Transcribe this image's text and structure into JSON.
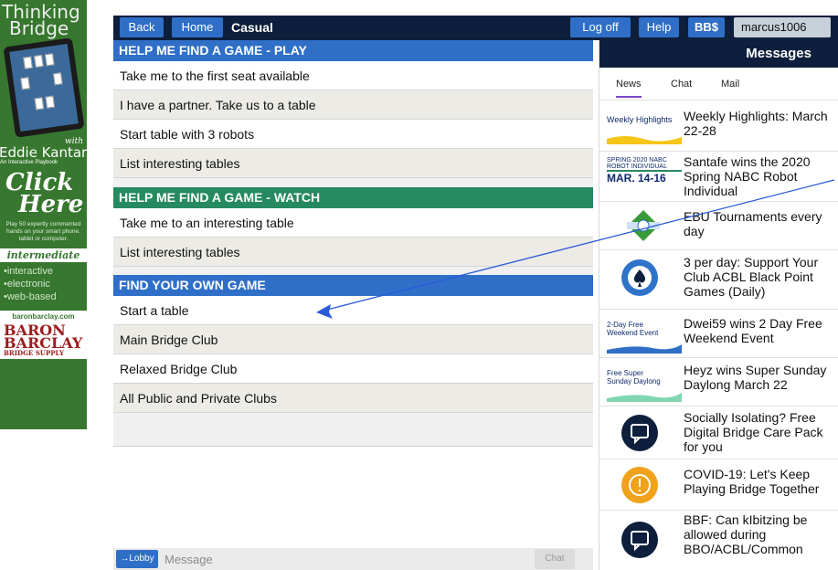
{
  "ad": {
    "brand_line1": "Thinking",
    "brand_line2": "Bridge",
    "with": "with",
    "author": "Eddie Kantar",
    "tagline": "An Interactive Playbook",
    "click_line1": "Click",
    "click_line2": "Here",
    "description": "Play 50 expertly commented hands on your smart phone, tablet or computer.",
    "level": "intermediate",
    "features": [
      "•interactive",
      "•electronic",
      "•web-based"
    ],
    "site": "baronbarclay.com",
    "logo_line1": "BARON",
    "logo_line2": "BARCLAY",
    "logo_line3": "BRIDGE SUPPLY"
  },
  "topbar": {
    "back": "Back",
    "home": "Home",
    "location": "Casual",
    "logoff": "Log off",
    "help": "Help",
    "bbs": "BB$",
    "username": "marcus1006"
  },
  "sections": {
    "play": {
      "title": "HELP ME FIND A GAME - PLAY",
      "items": [
        "Take me to the first seat available",
        "I have a partner. Take us to a table",
        "Start table with 3 robots",
        "List interesting tables"
      ]
    },
    "watch": {
      "title": "HELP ME FIND A GAME - WATCH",
      "items": [
        "Take me to an interesting table",
        "List interesting tables"
      ]
    },
    "own": {
      "title": "FIND YOUR OWN GAME",
      "items": [
        "Start a table",
        "Main Bridge Club",
        "Relaxed Bridge Club",
        "All Public and Private Clubs"
      ]
    }
  },
  "chat": {
    "lobby_button": "→Lobby",
    "placeholder": "Message",
    "chat_button": "Chat"
  },
  "messages": {
    "title": "Messages",
    "tabs": [
      "News",
      "Chat",
      "Mail"
    ],
    "news": [
      {
        "title": "Weekly Highlights: March 22-28",
        "thumb_text": "Weekly Highlights"
      },
      {
        "title": "Santafe wins the 2020 Spring NABC Robot Individual",
        "thumb_line1": "SPRING 2020 NABC",
        "thumb_line2": "ROBOT INDIVIDUAL",
        "thumb_line3": "MAR. 14-16"
      },
      {
        "title": "EBU Tournaments every day"
      },
      {
        "title": "3 per day: Support Your Club ACBL Black Point Games (Daily)"
      },
      {
        "title": "Dwei59 wins 2 Day Free Weekend Event",
        "thumb_line1": "2-Day Free",
        "thumb_line2": "Weekend Event"
      },
      {
        "title": "Heyz wins Super Sunday Daylong March 22",
        "thumb_line1": "Free Super",
        "thumb_line2": "Sunday Daylong"
      },
      {
        "title": "Socially Isolating? Free Digital Bridge Care Pack for you"
      },
      {
        "title": "COVID-19: Let's Keep Playing Bridge Together"
      },
      {
        "title": "BBF: Can kIbitzing be allowed during BBO/ACBL/Common"
      }
    ]
  },
  "colors": {
    "navy": "#0d1f3c",
    "blue": "#2f6fc7",
    "green": "#268a60",
    "ad_green": "#37772f",
    "arrow": "#2a5bd7"
  }
}
